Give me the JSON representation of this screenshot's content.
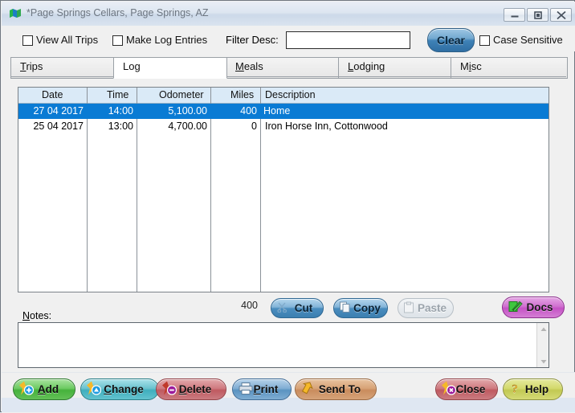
{
  "window": {
    "title": "*Page Springs Cellars, Page Springs, AZ",
    "icon": "map-app-icon",
    "controls": {
      "minimize": "minimize-icon",
      "maximize": "maximize-icon",
      "close": "close-icon"
    }
  },
  "header": {
    "view_all_trips_label": "View All Trips",
    "view_all_trips_checked": false,
    "make_log_entries_label": "Make Log Entries",
    "make_log_entries_checked": false,
    "filter_label": "Filter Desc:",
    "filter_value": "",
    "filter_placeholder": "",
    "clear_label": "Clear",
    "case_sensitive_label": "Case Sensitive",
    "case_sensitive_checked": false
  },
  "tabs": [
    {
      "label": "Trips",
      "mnemonic": "T",
      "active": false
    },
    {
      "label": "Log",
      "mnemonic": "",
      "active": true
    },
    {
      "label": "Meals",
      "mnemonic": "M",
      "active": false
    },
    {
      "label": "Lodging",
      "mnemonic": "L",
      "active": false
    },
    {
      "label": "Misc",
      "mnemonic": "i",
      "active": false
    }
  ],
  "grid": {
    "columns": [
      "Date",
      "Time",
      "Odometer",
      "Miles",
      "Description"
    ],
    "rows": [
      {
        "date": "27 04 2017",
        "time": "14:00",
        "odometer": "5,100.00",
        "miles": "400",
        "description": "Home",
        "selected": true
      },
      {
        "date": "25 04 2017",
        "time": "13:00",
        "odometer": "4,700.00",
        "miles": "0",
        "description": "Iron Horse Inn, Cottonwood",
        "selected": false
      }
    ],
    "selection_color": "#0a7bd4",
    "header_color": "#daeaf7"
  },
  "toolbar": {
    "total_miles": "400",
    "cut_label": "Cut",
    "copy_label": "Copy",
    "paste_label": "Paste",
    "paste_disabled": true,
    "docs_label": "Docs"
  },
  "notes": {
    "label": "Notes:",
    "mnemonic": "N",
    "value": "",
    "placeholder": ""
  },
  "buttons": [
    {
      "id": "add",
      "label": "Add",
      "mnemonic": "A",
      "color": "#46b23c"
    },
    {
      "id": "change",
      "label": "Change",
      "mnemonic": "C",
      "color": "#3faebd"
    },
    {
      "id": "delete",
      "label": "Delete",
      "mnemonic": "D",
      "color": "#bf5a60"
    },
    {
      "id": "print",
      "label": "Print",
      "mnemonic": "P",
      "color": "#5a93c1"
    },
    {
      "id": "sendto",
      "label": "Send To",
      "mnemonic": "",
      "color": "#c98c5d"
    },
    {
      "id": "close",
      "label": "Close",
      "mnemonic": "",
      "color": "#bf5a60"
    },
    {
      "id": "help",
      "label": "Help",
      "mnemonic": "",
      "color": "#c2c953"
    }
  ]
}
